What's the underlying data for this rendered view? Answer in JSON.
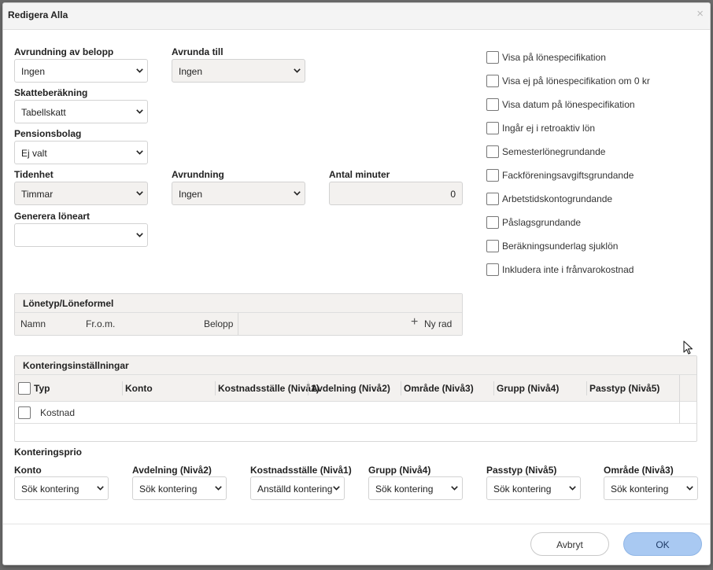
{
  "dialog": {
    "title": "Redigera Alla",
    "close_glyph": "×"
  },
  "left": {
    "rounding_amount": {
      "label": "Avrundning av belopp",
      "value": "Ingen"
    },
    "round_to": {
      "label": "Avrunda till",
      "value": "Ingen"
    },
    "tax_calc": {
      "label": "Skatteberäkning",
      "value": "Tabellskatt"
    },
    "pension": {
      "label": "Pensionsbolag",
      "value": "Ej valt"
    },
    "time_unit": {
      "label": "Tidenhet",
      "value": "Timmar"
    },
    "rounding": {
      "label": "Avrundning",
      "value": "Ingen"
    },
    "minutes": {
      "label": "Antal minuter",
      "value": "0"
    },
    "generate": {
      "label": "Generera löneart",
      "value": ""
    }
  },
  "checkboxes": [
    {
      "label": "Visa på lönespecifikation"
    },
    {
      "label": "Visa ej på lönespecifikation om 0 kr"
    },
    {
      "label": "Visa datum på lönespecifikation"
    },
    {
      "label": "Ingår ej i retroaktiv lön"
    },
    {
      "label": "Semesterlönegrundande"
    },
    {
      "label": "Fackföreningsavgiftsgrundande"
    },
    {
      "label": "Arbetstidskontogrundande"
    },
    {
      "label": "Påslagsgrundande"
    },
    {
      "label": "Beräkningsunderlag sjuklön"
    },
    {
      "label": "Inkludera inte i frånvarokostnad"
    }
  ],
  "formula_panel": {
    "title": "Lönetyp/Löneformel",
    "columns": [
      "Namn",
      "Fr.o.m.",
      "Belopp"
    ],
    "add_label": "Ny rad",
    "add_glyph": "+"
  },
  "accounting": {
    "title": "Konteringsinställningar",
    "columns": [
      "Typ",
      "Konto",
      "Kostnadsställe (Nivå1)",
      "Avdelning (Nivå2)",
      "Område (Nivå3)",
      "Grupp (Nivå4)",
      "Passtyp (Nivå5)"
    ],
    "row_label": "Kostnad"
  },
  "prio": {
    "title": "Konteringsprio",
    "items": [
      {
        "label": "Konto",
        "value": "Sök kontering"
      },
      {
        "label": "Avdelning (Nivå2)",
        "value": "Sök kontering"
      },
      {
        "label": "Kostnadsställe (Nivå1)",
        "value": "Anställd kontering"
      },
      {
        "label": "Grupp (Nivå4)",
        "value": "Sök kontering"
      },
      {
        "label": "Passtyp (Nivå5)",
        "value": "Sök kontering"
      },
      {
        "label": "Område (Nivå3)",
        "value": "Sök kontering"
      }
    ]
  },
  "footer": {
    "cancel_label": "Avbryt",
    "ok_label": "OK"
  },
  "colors": {
    "ok_button": "#a9c9f2",
    "panel_header": "#f3f1ef",
    "dialog_bg": "#ffffff"
  },
  "icons": {
    "chevron": "chevron-down-icon",
    "plus": "plus-icon",
    "close": "close-icon"
  }
}
